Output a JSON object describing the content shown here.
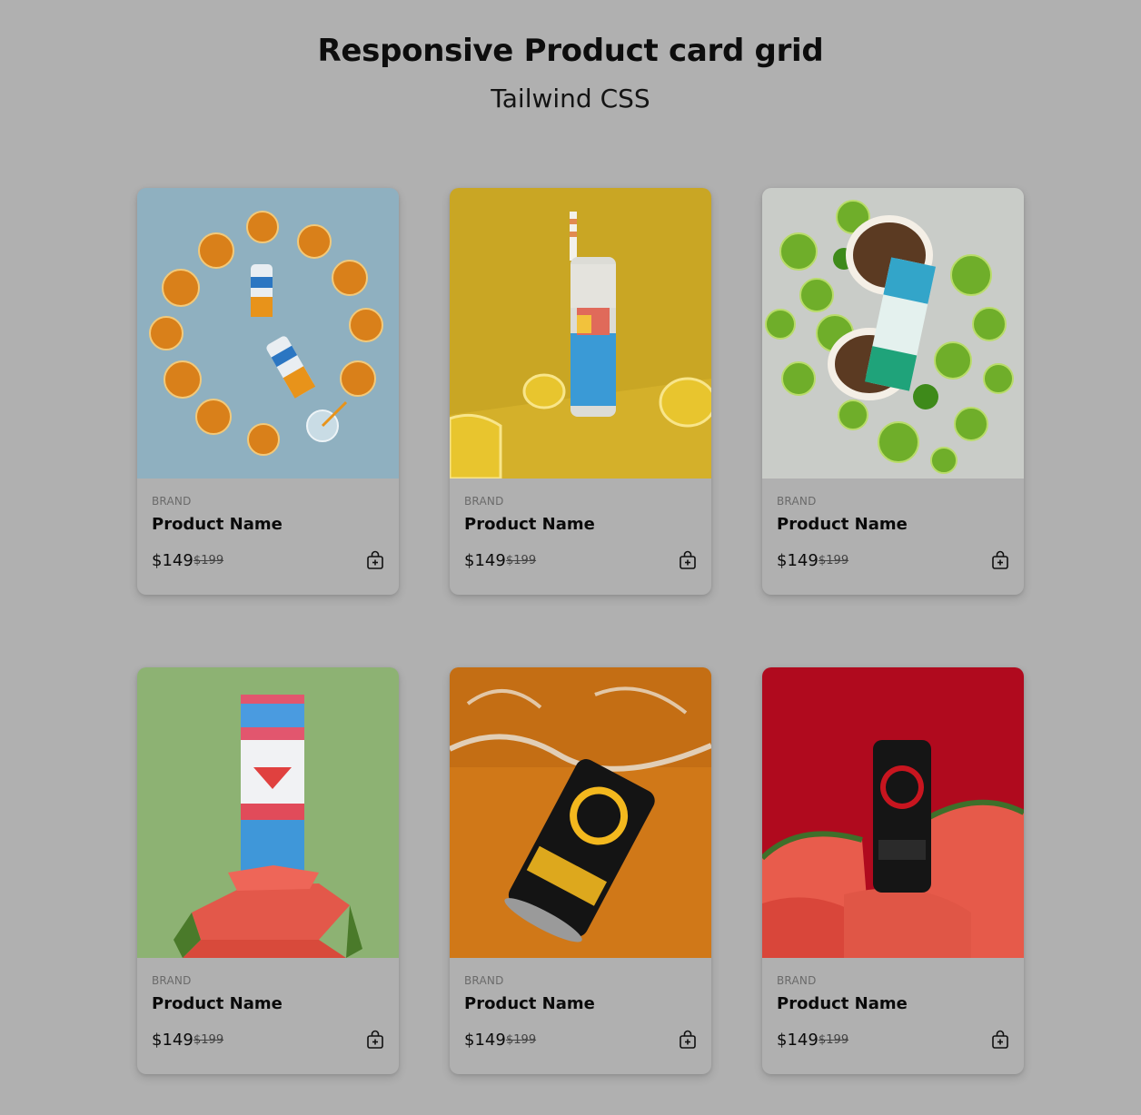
{
  "header": {
    "title": "Responsive Product card grid",
    "subtitle": "Tailwind CSS"
  },
  "products": [
    {
      "brand": "BRAND",
      "name": "Product Name",
      "price": "$149",
      "old_price": "$199",
      "image": "orange-slices-positive-energy-can",
      "bg": "#8fb0c0"
    },
    {
      "brand": "BRAND",
      "name": "Product Name",
      "price": "$149",
      "old_price": "$199",
      "image": "positive-beverage-can-lemons",
      "bg": "#c9a624"
    },
    {
      "brand": "BRAND",
      "name": "Product Name",
      "price": "$149",
      "old_price": "$199",
      "image": "positive-energy-can-limes-coconut",
      "bg": "#c9ccc8"
    },
    {
      "brand": "BRAND",
      "name": "Product Name",
      "price": "$149",
      "old_price": "$199",
      "image": "positive-energy-can-watermelon-stack",
      "bg": "#8db273"
    },
    {
      "brand": "BRAND",
      "name": "Product Name",
      "price": "$149",
      "old_price": "$199",
      "image": "riot-can-water-splash",
      "bg": "#d07818"
    },
    {
      "brand": "BRAND",
      "name": "Product Name",
      "price": "$149",
      "old_price": "$199",
      "image": "riot-can-watermelon",
      "bg": "#b00a1e"
    }
  ],
  "icons": {
    "cart": "shopping-bag-add-icon"
  }
}
